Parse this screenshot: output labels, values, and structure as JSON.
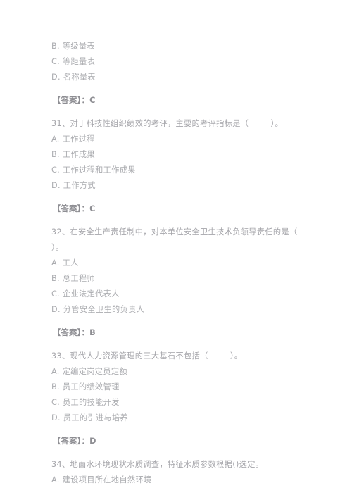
{
  "document": {
    "text_color": "#a9a9ad",
    "answer_color": "#8e8e93",
    "background_color": "#ffffff",
    "blocks": [
      {
        "type": "options_continued",
        "lines": [
          "B. 等级量表",
          "C. 等距量表",
          "D. 名称量表"
        ]
      },
      {
        "type": "answer",
        "lines": [
          "【答案】：C"
        ]
      },
      {
        "type": "question",
        "lines": [
          "31、对于科技性组织绩效的考评，主要的考评指标是（        ）。",
          "A. 工作过程",
          "B. 工作成果",
          "C. 工作过程和工作成果",
          "D. 工作方式"
        ]
      },
      {
        "type": "answer",
        "lines": [
          "【答案】：C"
        ]
      },
      {
        "type": "question",
        "lines": [
          "32、在安全生产责任制中，对本单位安全卫生技术负领导责任的是（",
          "）。",
          "A. 工人",
          "B. 总工程师",
          "C. 企业法定代表人",
          "D. 分管安全卫生的负责人"
        ]
      },
      {
        "type": "answer",
        "lines": [
          "【答案】：B"
        ]
      },
      {
        "type": "question",
        "lines": [
          "33、现代人力资源管理的三大基石不包括（        ）。",
          "A. 定编定岗定员定额",
          "B. 员工的绩效管理",
          "C. 员工的技能开发",
          "D. 员工的引进与培养"
        ]
      },
      {
        "type": "answer",
        "lines": [
          "【答案】：D"
        ]
      },
      {
        "type": "question",
        "lines": [
          "34、地面水环境现状水质调查，特征水质参数根据()选定。",
          "A. 建设项目所在地自然环境"
        ]
      }
    ]
  }
}
